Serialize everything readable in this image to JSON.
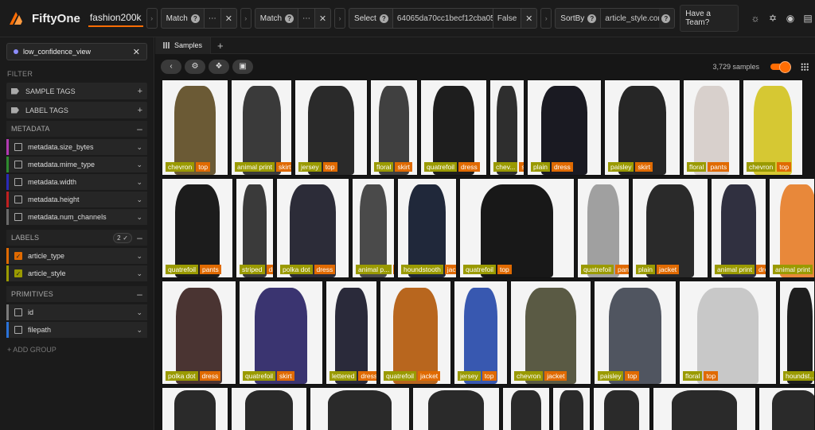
{
  "brand": {
    "name": "FiftyOne",
    "dataset": "fashion200k"
  },
  "view_bar": {
    "stages": [
      {
        "label": "Match",
        "value": "⋯"
      },
      {
        "label": "Match",
        "value": "⋯"
      },
      {
        "label": "Select",
        "value": "64065da70cc1becf12cba053...",
        "flag": "False"
      },
      {
        "label": "SortBy",
        "value": "article_style.conf"
      }
    ],
    "team_button": "Have a Team?"
  },
  "sidebar": {
    "view_name": "low_confidence_view",
    "filter_title": "FILTER",
    "sample_tags": "SAMPLE TAGS",
    "label_tags": "LABEL TAGS",
    "metadata_title": "METADATA",
    "metadata_fields": [
      "metadata.size_bytes",
      "metadata.mime_type",
      "metadata.width",
      "metadata.height",
      "metadata.num_channels"
    ],
    "labels_title": "LABELS",
    "labels_count": "2",
    "label_fields": [
      "article_type",
      "article_style"
    ],
    "primitives_title": "PRIMITIVES",
    "primitive_fields": [
      "id",
      "filepath"
    ],
    "add_group": "+ ADD GROUP"
  },
  "main": {
    "tab_label": "Samples",
    "sample_count": "3,729 samples"
  },
  "colors": {
    "accent": "#ff6d04",
    "style_label": "#9a9a00",
    "type_label": "#e06a00",
    "field_stripes": [
      "#b23ab2",
      "#2e8b2e",
      "#2a2ab8",
      "#c02020",
      "#6a6a6a",
      "#e06a00",
      "#9a9a00",
      "#7a7a7a",
      "#2a72d8"
    ]
  },
  "samples": [
    {
      "style": "chevron",
      "type": "top",
      "color": "#6b5a35"
    },
    {
      "style": "animal print",
      "type": "skirt",
      "color": "#3a3a3a"
    },
    {
      "style": "jersey",
      "type": "top",
      "color": "#2a2a2a"
    },
    {
      "style": "floral",
      "type": "skirt",
      "color": "#404040"
    },
    {
      "style": "quatrefoil",
      "type": "dress",
      "color": "#1e1e1e"
    },
    {
      "style": "chev...",
      "type": "skirt",
      "color": "#2e2e2e"
    },
    {
      "style": "plain",
      "type": "dress",
      "color": "#1a1a22"
    },
    {
      "style": "paisley",
      "type": "skirt",
      "color": "#262626"
    },
    {
      "style": "floral",
      "type": "pants",
      "color": "#d8d0cc"
    },
    {
      "style": "chevron",
      "type": "top",
      "color": "#d6c833"
    },
    {
      "style": "quatrefoil",
      "type": "pants",
      "color": "#1c1c1c"
    },
    {
      "style": "striped",
      "type": "dress",
      "color": "#3a3a3a"
    },
    {
      "style": "polka dot",
      "type": "dress",
      "color": "#2c2c38"
    },
    {
      "style": "animal p...",
      "type": "skirt",
      "color": "#4a4a4a"
    },
    {
      "style": "houndstooth",
      "type": "jacket",
      "color": "#20283a"
    },
    {
      "style": "quatrefoil",
      "type": "top",
      "color": "#181818"
    },
    {
      "style": "quatrefoil",
      "type": "pants",
      "color": "#a0a0a0"
    },
    {
      "style": "plain",
      "type": "jacket",
      "color": "#2a2a2a"
    },
    {
      "style": "animal print",
      "type": "dress",
      "color": "#303040"
    },
    {
      "style": "animal print",
      "type": "pants",
      "color": "#e8883a"
    },
    {
      "style": "polka dot",
      "type": "dress",
      "color": "#4a3432"
    },
    {
      "style": "quatrefoil",
      "type": "skirt",
      "color": "#3a3470"
    },
    {
      "style": "lettered",
      "type": "dress",
      "color": "#2a2a3a"
    },
    {
      "style": "quatrefoil",
      "type": "jacket",
      "color": "#b8661e"
    },
    {
      "style": "jersey",
      "type": "top",
      "color": "#3858b0"
    },
    {
      "style": "chevron",
      "type": "jacket",
      "color": "#5a5a44"
    },
    {
      "style": "paisley",
      "type": "top",
      "color": "#505560"
    },
    {
      "style": "floral",
      "type": "top",
      "color": "#c8c8c8"
    },
    {
      "style": "houndst...",
      "type": "dress",
      "color": "#1e1e1e"
    }
  ]
}
